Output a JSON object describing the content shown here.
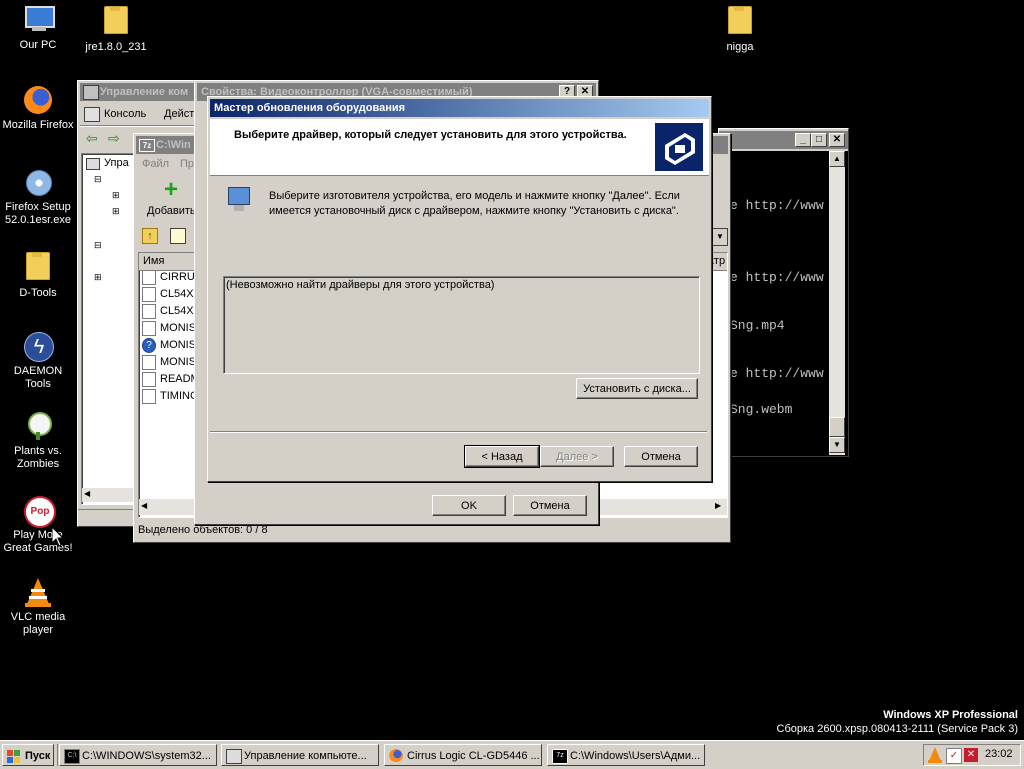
{
  "desktop": {
    "icons": [
      {
        "label": "Our PC",
        "icon": "computer-icon"
      },
      {
        "label": "jre1.8.0_231",
        "icon": "folder-icon"
      },
      {
        "label": "nigga",
        "icon": "folder-icon"
      },
      {
        "label": "Mozilla Firefox",
        "icon": "firefox-icon"
      },
      {
        "label": "Firefox Setup 52.0.1esr.exe",
        "icon": "installer-icon"
      },
      {
        "label": "D-Tools",
        "icon": "folder-icon"
      },
      {
        "label": "DAEMON Tools",
        "icon": "daemon-tools-icon"
      },
      {
        "label": "Plants vs. Zombies",
        "icon": "plants-vs-zombies-icon"
      },
      {
        "label": "Play More Great Games!",
        "icon": "popcap-icon"
      },
      {
        "label": "VLC media player",
        "icon": "vlc-icon"
      }
    ],
    "watermark": {
      "edition": "Windows XP Professional",
      "build": "Сборка 2600.xpsp.080413-2111 (Service Pack 3)"
    }
  },
  "console_window": {
    "title": "Управление ком",
    "menu": [
      "Консоль",
      "Дейст"
    ],
    "tree_item": "Упра"
  },
  "terminal_window": {
    "lines": [
      "e http://www",
      "e http://www",
      "Sng.mp4",
      "e http://www",
      "Sng.webm"
    ]
  },
  "explorer_window": {
    "title": "C:\\Win",
    "menu": [
      "Файл",
      "Пр"
    ],
    "add_label": "Добавить",
    "column_name": "Имя",
    "column_right": "ктр",
    "files": [
      "CIRRUS",
      "CL54XX",
      "CL54XX",
      "MONIS",
      "MONIS",
      "MONIS",
      "README",
      "TIMING"
    ],
    "status": "Выделено объектов: 0 / 8"
  },
  "properties_window": {
    "title": "Свойства: Видеоконтроллер (VGA-совместимый)",
    "ok_label": "OK",
    "cancel_label": "Отмена"
  },
  "wizard": {
    "title": "Мастер обновления оборудования",
    "header": "Выберите драйвер, который следует установить для этого устройства.",
    "instructions": "Выберите изготовителя устройства, его модель и нажмите кнопку \"Далее\". Если имеется установочный диск с  драйвером, нажмите кнопку \"Установить с диска\".",
    "list_message": "(Невозможно найти драйверы для этого устройства)",
    "have_disk_label": "Установить с диска...",
    "back_label": "< Назад",
    "next_label": "Далее >",
    "cancel_label": "Отмена"
  },
  "taskbar": {
    "start_label": "Пуск",
    "buttons": [
      {
        "label": "C:\\WINDOWS\\system32...",
        "icon": "cmd-icon"
      },
      {
        "label": "Управление компьюте...",
        "icon": "computer-management-icon"
      },
      {
        "label": "Cirrus Logic CL-GD5446 ...",
        "icon": "firefox-icon"
      },
      {
        "label": "C:\\Windows\\Users\\Адми...",
        "icon": "7zip-icon"
      }
    ],
    "clock": "23:02"
  },
  "colors": {
    "desktop": "#000000",
    "active_title_start": "#0a246a",
    "active_title_end": "#a6caf0",
    "window_face": "#d4d0c8"
  }
}
